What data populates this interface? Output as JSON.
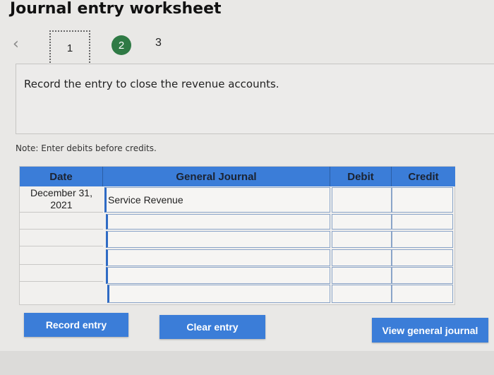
{
  "header": {
    "title": "Journal entry worksheet"
  },
  "stepper": {
    "prev_icon": "chevron-left-icon",
    "steps": [
      "1",
      "2",
      "3"
    ],
    "active_step": "2",
    "active_color": "#2f7a45"
  },
  "prompt": {
    "text": "Record the entry to close the revenue accounts."
  },
  "note": "Note: Enter debits before credits.",
  "journal": {
    "columns": {
      "date": "Date",
      "general_journal": "General Journal",
      "debit": "Debit",
      "credit": "Credit"
    },
    "header_color": "#3b7dd8",
    "rows": [
      {
        "date": "December 31, 2021",
        "account": "Service Revenue",
        "debit": "",
        "credit": ""
      },
      {
        "date": "",
        "account": "",
        "debit": "",
        "credit": ""
      },
      {
        "date": "",
        "account": "",
        "debit": "",
        "credit": ""
      },
      {
        "date": "",
        "account": "",
        "debit": "",
        "credit": ""
      },
      {
        "date": "",
        "account": "",
        "debit": "",
        "credit": ""
      },
      {
        "date": "",
        "account": "",
        "debit": "",
        "credit": ""
      }
    ]
  },
  "buttons": {
    "record": "Record entry",
    "clear": "Clear entry",
    "view": "View general journal"
  }
}
